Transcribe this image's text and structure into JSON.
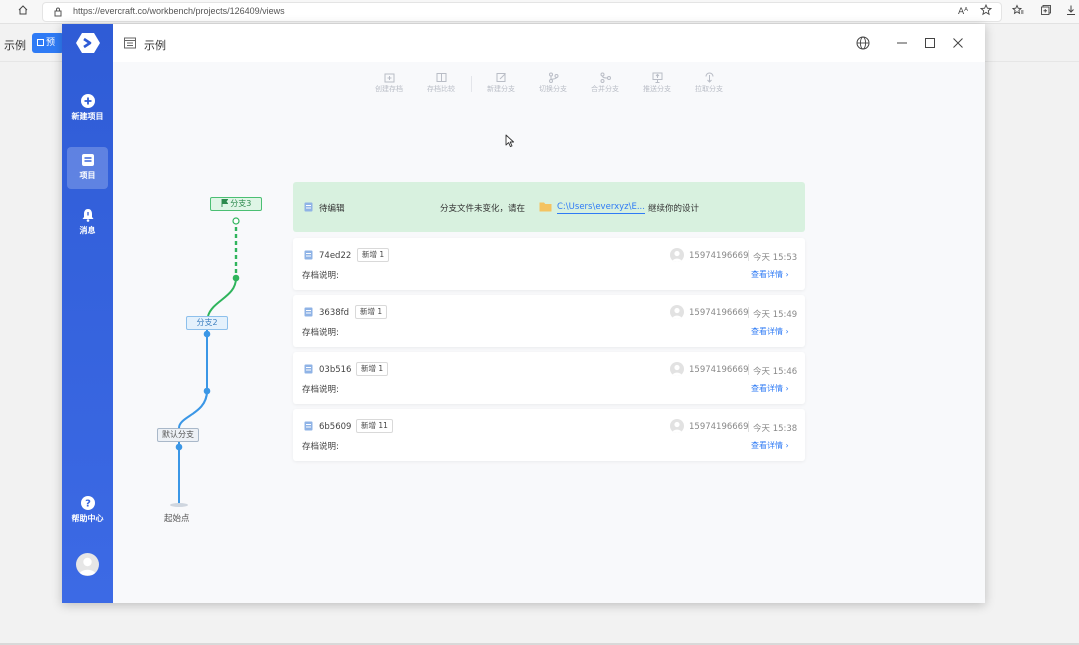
{
  "browser": {
    "url": "https://evercraft.co/workbench/projects/126409/views",
    "reader_label": "Aᴬ"
  },
  "underlying_page": {
    "title": "示例",
    "button_label": "预"
  },
  "sidebar": {
    "items": [
      {
        "label": "新建项目",
        "icon": "plus-circle-icon"
      },
      {
        "label": "项目",
        "icon": "folder-icon",
        "active": true
      },
      {
        "label": "消息",
        "icon": "bell-icon"
      }
    ],
    "help_label": "帮助中心"
  },
  "window": {
    "title": "示例"
  },
  "toolbar": {
    "items": [
      {
        "label": "创建存档",
        "icon": "archive-create-icon"
      },
      {
        "label": "存档比较",
        "icon": "compare-icon"
      },
      {
        "label": "新建分支",
        "icon": "new-branch-icon"
      },
      {
        "label": "切换分支",
        "icon": "switch-branch-icon"
      },
      {
        "label": "合并分支",
        "icon": "merge-branch-icon"
      },
      {
        "label": "推送分支",
        "icon": "push-branch-icon"
      },
      {
        "label": "拉取分支",
        "icon": "pull-branch-icon"
      }
    ]
  },
  "graph": {
    "branch3": "分支3",
    "branch2": "分支2",
    "default_branch": "默认分支",
    "start": "起始点",
    "colors": {
      "green": "#2fb45c",
      "blue": "#3b97e6"
    }
  },
  "pending": {
    "label": "待编辑",
    "message": "分支文件未变化，请在",
    "path": "C:\\Users\\everxyz\\E...",
    "tail": "继续你的设计"
  },
  "commits": [
    {
      "hash": "74ed22",
      "badge": "新增",
      "count": "1",
      "note": "存档说明:",
      "user": "15974196669",
      "time": "今天 15:53",
      "detail": "查看详情"
    },
    {
      "hash": "3638fd",
      "badge": "新增",
      "count": "1",
      "note": "存档说明:",
      "user": "15974196669",
      "time": "今天 15:49",
      "detail": "查看详情"
    },
    {
      "hash": "03b516",
      "badge": "新增",
      "count": "1",
      "note": "存档说明:",
      "user": "15974196669",
      "time": "今天 15:46",
      "detail": "查看详情"
    },
    {
      "hash": "6b5609",
      "badge": "新增",
      "count": "11",
      "note": "存档说明:",
      "user": "15974196669",
      "time": "今天 15:38",
      "detail": "查看详情"
    }
  ]
}
